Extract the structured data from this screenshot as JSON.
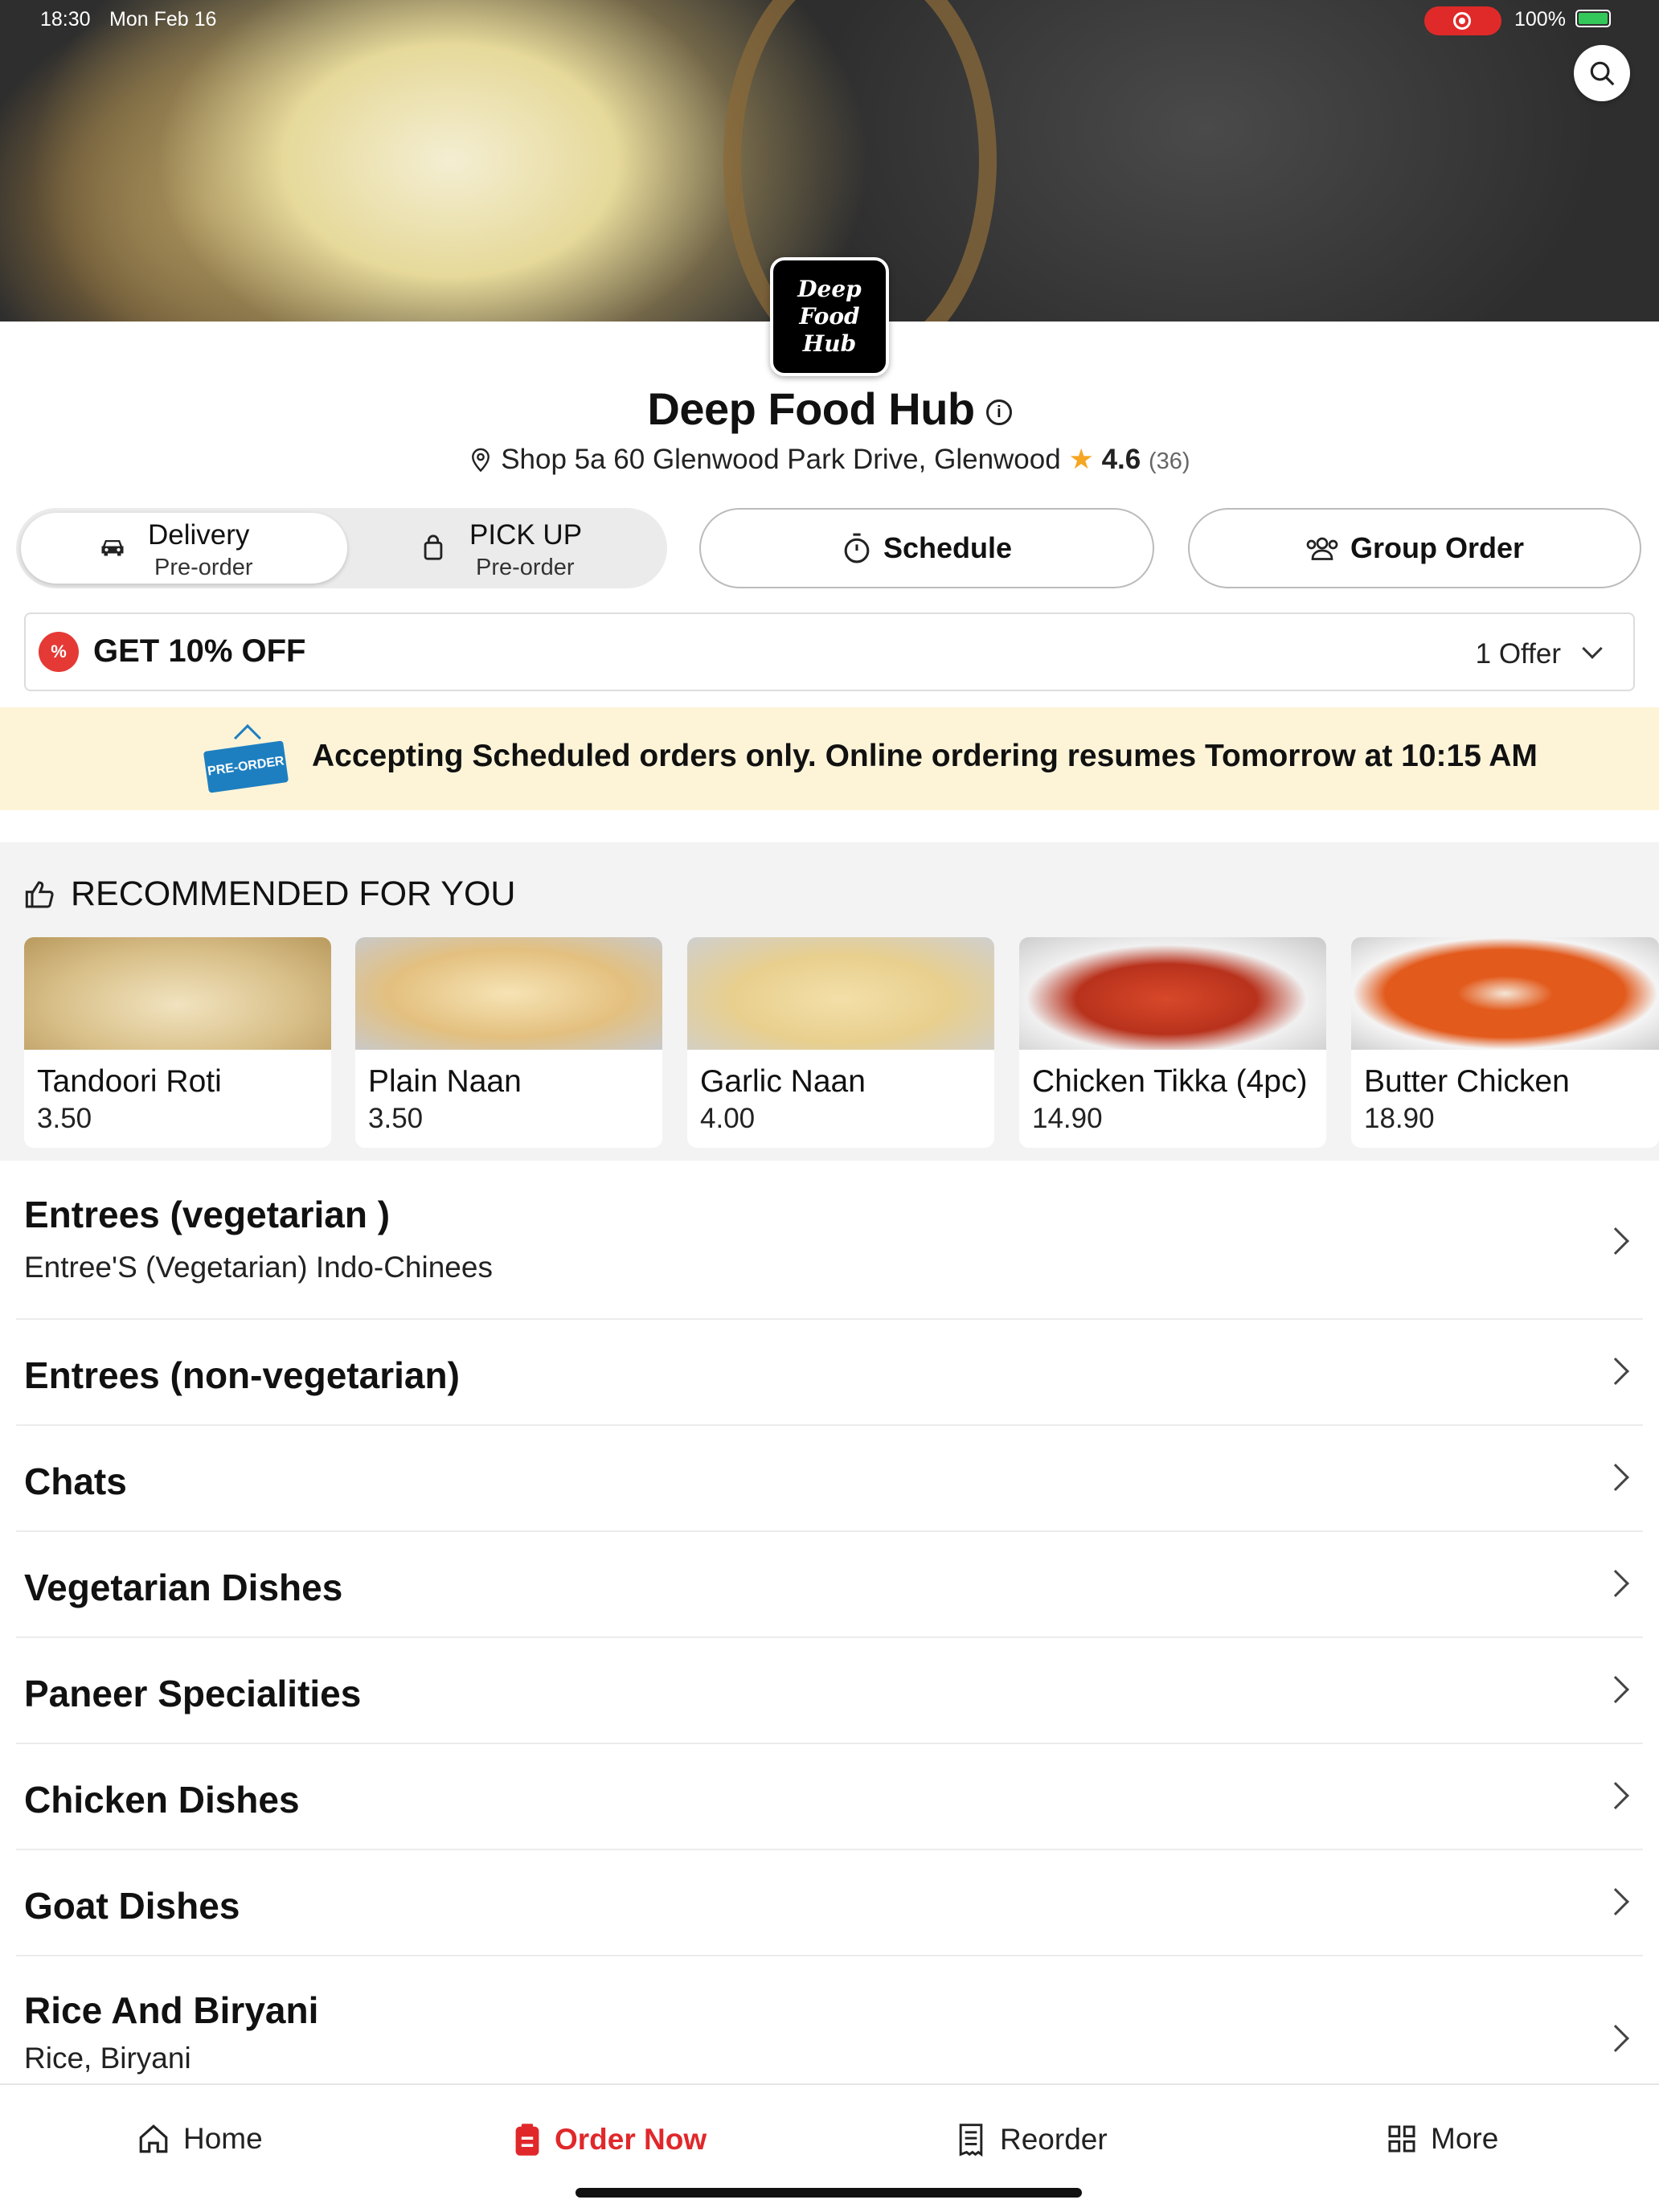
{
  "status_bar": {
    "time": "18:30",
    "date": "Mon Feb 16",
    "battery": "100%"
  },
  "restaurant": {
    "logo_line1": "Deep",
    "logo_line2": "Food Hub",
    "name": "Deep Food Hub",
    "address": "Shop 5a 60 Glenwood Park Drive, Glenwood",
    "rating": "4.6",
    "rating_count": "(36)"
  },
  "order_mode": {
    "delivery": {
      "label": "Delivery",
      "sub": "Pre-order",
      "selected": true
    },
    "pickup": {
      "label": "PICK UP",
      "sub": "Pre-order",
      "selected": false
    },
    "schedule": "Schedule",
    "group_order": "Group Order"
  },
  "offer": {
    "title": "GET 10% OFF",
    "count": "1 Offer"
  },
  "notice": {
    "tag": "PRE-ORDER",
    "text": "Accepting Scheduled orders only. Online ordering resumes Tomorrow at 10:15 AM"
  },
  "recommended": {
    "heading": "RECOMMENDED FOR YOU",
    "items": [
      {
        "name": "Tandoori Roti",
        "price": "3.50",
        "color": "#d9c08a"
      },
      {
        "name": "Plain Naan",
        "price": "3.50",
        "color": "#e3c07f"
      },
      {
        "name": "Garlic Naan",
        "price": "4.00",
        "color": "#e8cf8e"
      },
      {
        "name": "Chicken Tikka (4pc)",
        "price": "14.90",
        "color": "#b8321c"
      },
      {
        "name": "Butter Chicken",
        "price": "18.90",
        "color": "#e25a1c"
      }
    ]
  },
  "categories": [
    {
      "title": "Entrees (vegetarian )",
      "sub": "Entree'S (Vegetarian) Indo-Chinees"
    },
    {
      "title": "Entrees (non-vegetarian)",
      "sub": ""
    },
    {
      "title": "Chats",
      "sub": ""
    },
    {
      "title": "Vegetarian Dishes",
      "sub": ""
    },
    {
      "title": "Paneer Specialities",
      "sub": ""
    },
    {
      "title": "Chicken Dishes",
      "sub": ""
    },
    {
      "title": "Goat Dishes",
      "sub": ""
    },
    {
      "title": "Rice And Biryani",
      "sub": "Rice, Biryani"
    }
  ],
  "tabbar": {
    "home": "Home",
    "order_now": "Order Now",
    "reorder": "Reorder",
    "more": "More",
    "active_color": "#e0282b"
  }
}
